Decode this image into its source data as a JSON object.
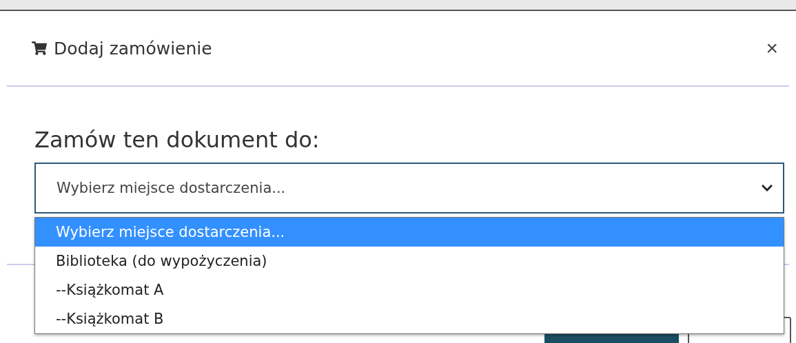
{
  "dialog": {
    "title": "Dodaj zamówienie",
    "close": "×"
  },
  "question": "Zamów ten dokument do:",
  "select": {
    "value": "Wybierz miejsce dostarczenia...",
    "expanded": true
  },
  "options": [
    {
      "label": "Wybierz miejsce dostarczenia...",
      "selected": true
    },
    {
      "label": "Biblioteka (do wypożyczenia)",
      "selected": false
    },
    {
      "label": "--Książkomat A",
      "selected": false
    },
    {
      "label": "--Książkomat B",
      "selected": false
    }
  ]
}
